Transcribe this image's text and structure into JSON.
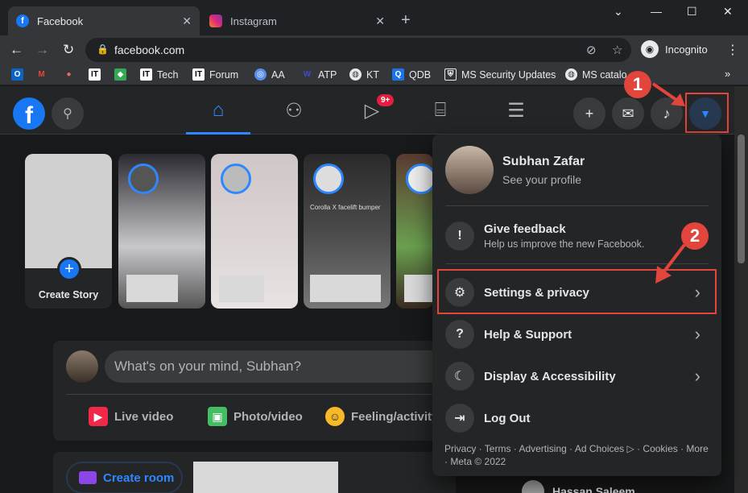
{
  "browser": {
    "tabs": [
      {
        "label": "Facebook",
        "icon": "facebook-favicon"
      },
      {
        "label": "Instagram",
        "icon": "instagram-favicon"
      }
    ],
    "tab_close": "✕",
    "new_tab": "+",
    "url": "facebook.com",
    "incognito_label": "Incognito",
    "bookmarks": [
      "Tech",
      "Forum",
      "AA",
      "ATP",
      "KT",
      "QDB",
      "MS Security Updates",
      "MS catalo"
    ],
    "bookmark_more": "»"
  },
  "fbnav": {
    "logo": "f",
    "watch_badge": "9+"
  },
  "annotations": {
    "step1": "1",
    "step2": "2"
  },
  "stories": {
    "create_label": "Create Story",
    "caption": "Corolla X facelift bumper"
  },
  "composer": {
    "placeholder": "What's on your mind, Subhan?",
    "actions": [
      "Live video",
      "Photo/video",
      "Feeling/activity"
    ],
    "create_room": "Create room"
  },
  "contacts": {
    "first": "Hassan Saleem"
  },
  "menu": {
    "profile_name": "Subhan Zafar",
    "profile_sub": "See your profile",
    "feedback_label": "Give feedback",
    "feedback_desc": "Help us improve the new Facebook.",
    "items": [
      "Settings & privacy",
      "Help & Support",
      "Display & Accessibility",
      "Log Out"
    ],
    "footer": "Privacy · Terms · Advertising · Ad Choices ▷ · Cookies · More · Meta © 2022"
  },
  "colors": {
    "accent": "#2d88ff",
    "highlight": "#e2453c",
    "surface": "#242526",
    "background": "#18191a"
  }
}
